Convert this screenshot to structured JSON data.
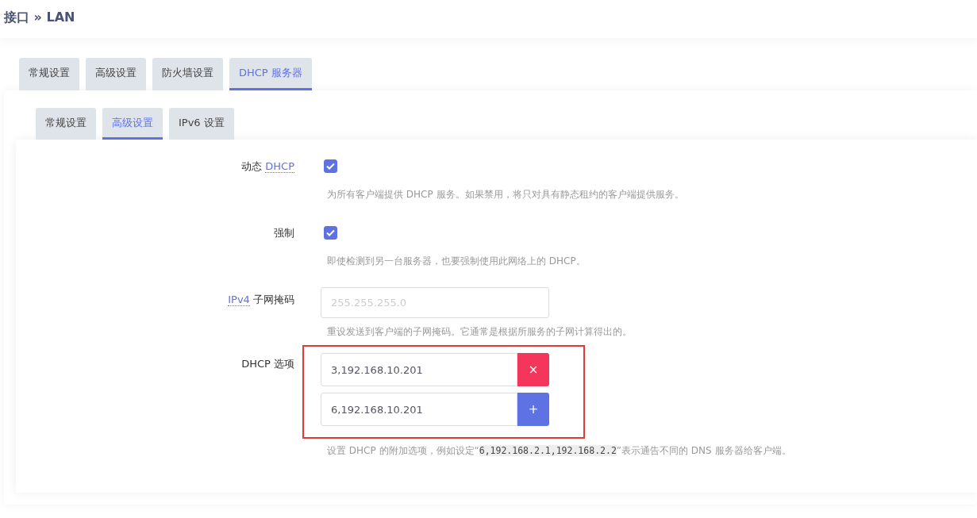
{
  "page_title": "接口 » LAN",
  "tabs": [
    {
      "label": "常规设置",
      "selected": false
    },
    {
      "label": "高级设置",
      "selected": false
    },
    {
      "label": "防火墙设置",
      "selected": false
    },
    {
      "label": "DHCP 服务器",
      "selected": true
    }
  ],
  "subtabs": [
    {
      "label": "常规设置",
      "selected": false
    },
    {
      "label": "高级设置",
      "selected": true
    },
    {
      "label": "IPv6 设置",
      "selected": false
    }
  ],
  "fields": [
    {
      "kind": "checkbox",
      "label": [
        {
          "text": "动态 ",
          "abbr": false
        },
        {
          "text": "DHCP",
          "abbr": true
        }
      ],
      "checked": true,
      "help": "为所有客户端提供 DHCP 服务。如果禁用，将只对具有静态租约的客户端提供服务。"
    },
    {
      "kind": "checkbox",
      "label": [
        {
          "text": "强制",
          "abbr": false
        }
      ],
      "checked": true,
      "help": "即使检测到另一台服务器，也要强制使用此网络上的 DHCP。"
    },
    {
      "kind": "text",
      "label": [
        {
          "text": "IPv4",
          "abbr": true
        },
        {
          "text": " 子网掩码",
          "abbr": false
        }
      ],
      "placeholder": "255.255.255.0",
      "help": "重设发送到客户端的子网掩码。它通常是根据所服务的子网计算得出的。"
    },
    {
      "kind": "list",
      "label": [
        {
          "text": "DHCP 选项",
          "abbr": false
        }
      ],
      "highlighted": true,
      "items": [
        {
          "value": "3,192.168.10.201",
          "kind": "remove",
          "symbol": "×"
        },
        {
          "value": "6,192.168.10.201",
          "kind": "add",
          "symbol": "+"
        }
      ],
      "help_parts": [
        {
          "text": "设置 DHCP 的附加选项，例如设定“",
          "code": false
        },
        {
          "text": "6,192.168.2.1,192.168.2.2",
          "code": true
        },
        {
          "text": "”表示通告不同的 DNS 服务器给客户端。",
          "code": false
        }
      ]
    }
  ]
}
